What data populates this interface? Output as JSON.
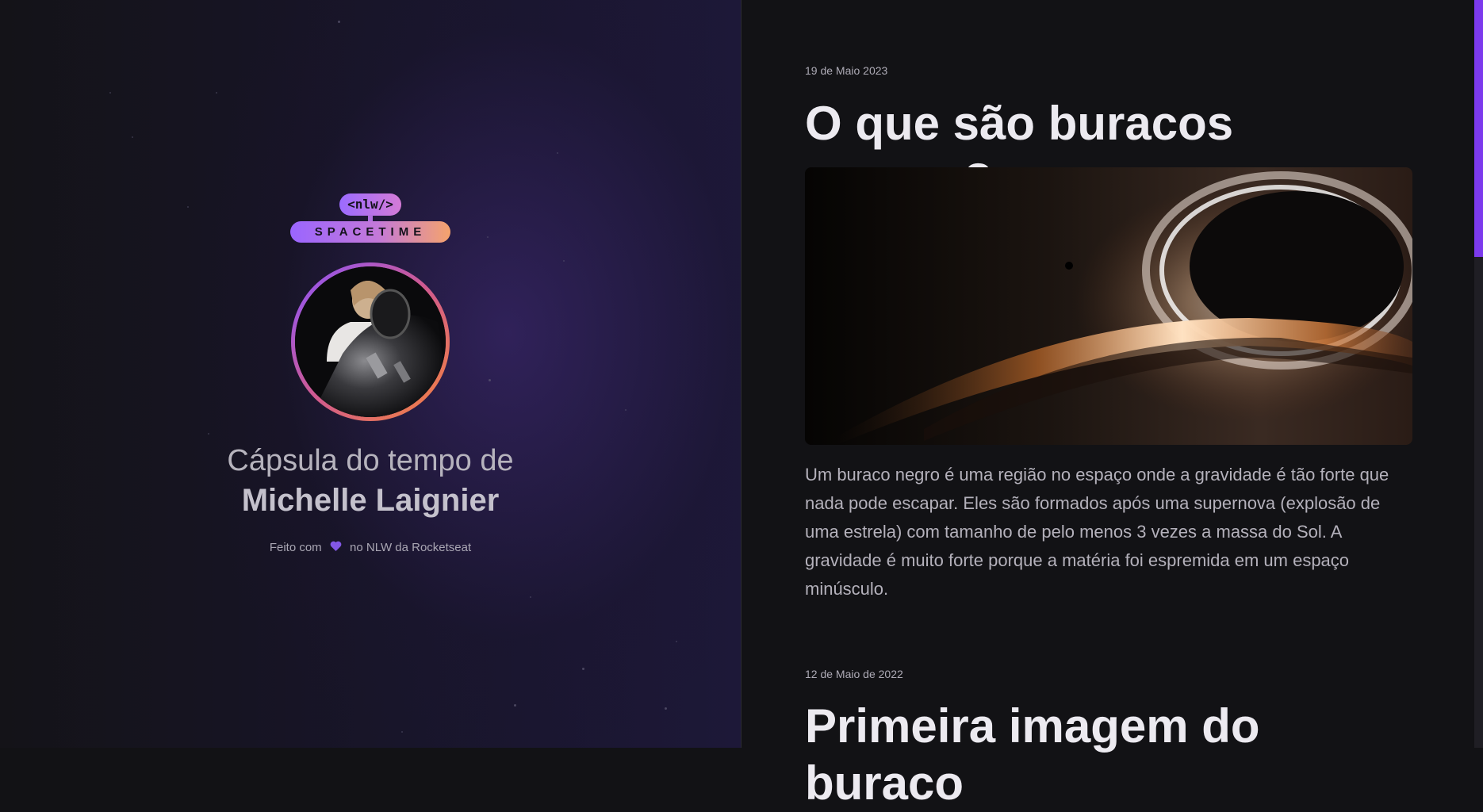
{
  "brand": {
    "logo_top": "<nlw/>",
    "logo_bottom": "SPACETIME"
  },
  "profile": {
    "capsule_prefix": "Cápsula do tempo de",
    "name": "Michelle Laignier",
    "made_with_prefix": "Feito com",
    "made_with_suffix": "no NLW da Rocketseat"
  },
  "memories": [
    {
      "date": "19 de Maio 2023",
      "title": "O que são buracos negros?",
      "text": "Um buraco negro é uma região no espaço onde a gravidade é tão forte que nada pode escapar. Eles são formados após uma supernova (explosão de uma estrela) com tamanho de pelo menos 3 vezes a massa do Sol. A gravidade é muito forte porque a matéria foi espremida em um espaço minúsculo."
    },
    {
      "date": "12 de Maio de 2022",
      "title": "Primeira imagem do buraco"
    }
  ],
  "colors": {
    "accent": "#8257e5",
    "scrollbar_thumb": "#7c3aed",
    "background": "#121215"
  },
  "icons": {
    "heart": "heart-icon"
  }
}
